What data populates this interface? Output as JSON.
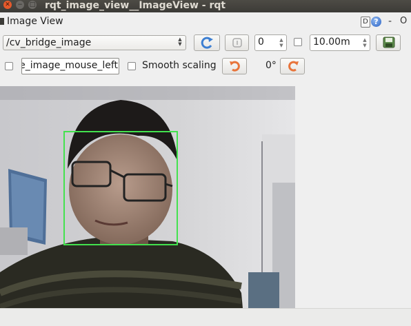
{
  "window": {
    "title": "rqt_image_view__ImageView - rqt"
  },
  "window_controls": {
    "close": "✕",
    "minimize": "−",
    "maximize": "□"
  },
  "plugin": {
    "title": "Image View",
    "d_label": "D",
    "help_label": "?",
    "minimize_label": "-",
    "close_label": "O"
  },
  "toolbar": {
    "topic": "/cv_bridge_image",
    "num_gridlines": "0",
    "max_range": "10.00m",
    "mouse_topic": "e_image_mouse_left",
    "smooth_scaling_label": "Smooth scaling",
    "rotation": "0°",
    "icons": [
      "refresh-icon",
      "zoom-1-icon",
      "save-icon",
      "rotate-left-icon",
      "rotate-right-icon"
    ]
  },
  "colors": {
    "detection_box": "#43e24e",
    "accent_orange": "#e8743b",
    "accent_blue": "#3d7fd2"
  }
}
